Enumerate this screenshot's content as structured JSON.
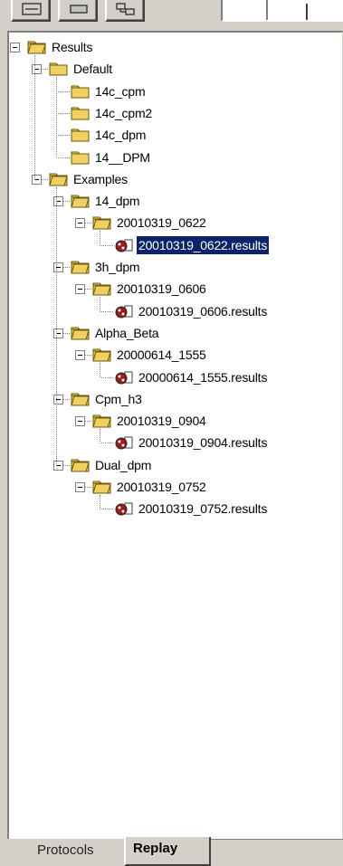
{
  "toolbar": {
    "buttons": [
      {
        "name": "toolbar-button-1",
        "icon": "list-icon"
      },
      {
        "name": "toolbar-button-2",
        "icon": "minus-icon"
      },
      {
        "name": "toolbar-button-3",
        "icon": "tree-icon"
      }
    ]
  },
  "tree": {
    "root": "Results",
    "default": "Default",
    "default_items": [
      "14c_cpm",
      "14c_cpm2",
      "14c_dpm",
      "14__DPM"
    ],
    "examples": "Examples",
    "groups": [
      {
        "label": "14_dpm",
        "run": "20010319_0622",
        "result": "20010319_0622.results",
        "selected": true
      },
      {
        "label": "3h_dpm",
        "run": "20010319_0606",
        "result": "20010319_0606.results",
        "selected": false
      },
      {
        "label": "Alpha_Beta",
        "run": "20000614_1555",
        "result": "20000614_1555.results",
        "selected": false
      },
      {
        "label": "Cpm_h3",
        "run": "20010319_0904",
        "result": "20010319_0904.results",
        "selected": false
      },
      {
        "label": "Dual_dpm",
        "run": "20010319_0752",
        "result": "20010319_0752.results",
        "selected": false
      }
    ]
  },
  "tabs": {
    "protocols": "Protocols",
    "replay": "Replay"
  },
  "colors": {
    "selection": "#0a246a",
    "folder": "#f0d060",
    "face": "#d4d0c8"
  }
}
